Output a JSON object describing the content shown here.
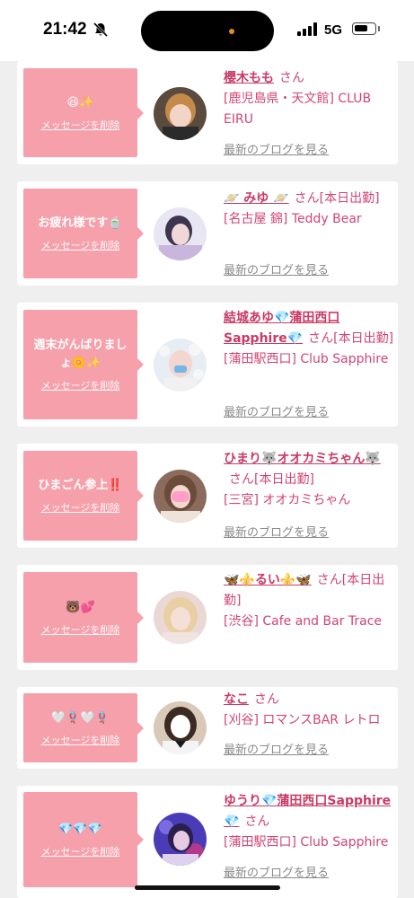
{
  "status": {
    "time": "21:42",
    "network": "5G",
    "icons": [
      "bell-slash-icon",
      "signal-icon",
      "battery-icon"
    ]
  },
  "colors": {
    "bubble": "#f6a0ab",
    "name": "#c93a66",
    "text_pink": "#d24472",
    "link_gray": "#8a8a8a",
    "background": "#efefef"
  },
  "delete_label": "メッセージを削除",
  "blog_label": "最新のブログを見る",
  "cards": [
    {
      "message": "😆✨",
      "name": "櫻木もも",
      "san": "さん",
      "place": "[鹿児島県・天文館] CLUB EIRU"
    },
    {
      "message": "お疲れ様です🍵",
      "name": "🪐 みゆ 🪐",
      "san": "さん[本日出勤]",
      "place": "[名古屋 錦] Teddy Bear"
    },
    {
      "message": "週末がんばりましょ🌼✨",
      "name": "結城あゆ💎蒲田西口Sapphire💎",
      "san": "さん[本日出勤]",
      "place": "[蒲田駅西口] Club Sapphire"
    },
    {
      "message": "ひまごん参上‼️",
      "name": "ひまり🐺オオカミちゃん🐺",
      "san": "さん[本日出勤]",
      "place": "[三宮] オオカミちゃん"
    },
    {
      "message": "🐻💕",
      "name": "🦋⚜️るい⚜️🦋",
      "san": "さん[本日出勤]",
      "place": "[渋谷] Cafe and Bar Trace"
    },
    {
      "message": "🤍🪢🤍🪢",
      "name": "なこ",
      "san": "さん",
      "place": "[刈谷] ロマンスBAR レトロ"
    },
    {
      "message": "💎💎💎",
      "name": "ゆうり💎蒲田西口Sapphire💎",
      "san": "さん",
      "place": "[蒲田駅西口] Club Sapphire"
    }
  ]
}
